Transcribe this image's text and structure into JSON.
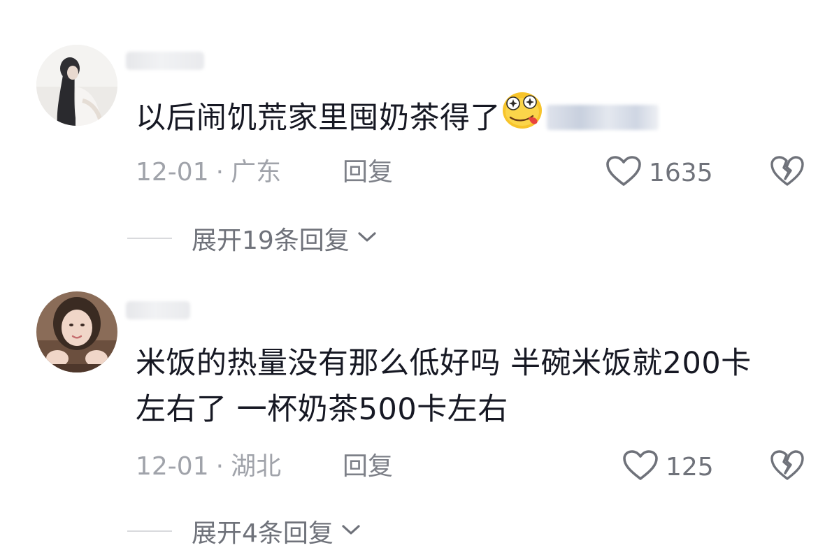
{
  "comments": [
    {
      "text": "以后闹饥荒家里囤奶茶得了",
      "date": "12-01",
      "separator": "·",
      "location": "广东",
      "reply_label": "回复",
      "like_count": "1635",
      "expand_label": "展开19条回复",
      "emoji": "drooling-face-emoji"
    },
    {
      "text_line1": "米饭的热量没有那么低好吗 半碗米饭就200卡",
      "text_line2": "左右了 一杯奶茶500卡左右",
      "date": "12-01",
      "separator": "·",
      "location": "湖北",
      "reply_label": "回复",
      "like_count": "125",
      "expand_label": "展开4条回复"
    }
  ],
  "icons": {
    "like": "heart-outline-icon",
    "dislike": "broken-heart-icon",
    "expand": "chevron-down-icon"
  },
  "colors": {
    "text_primary": "#161823",
    "text_meta": "#a0a3aa",
    "text_secondary": "#6f727a",
    "background": "#ffffff"
  }
}
